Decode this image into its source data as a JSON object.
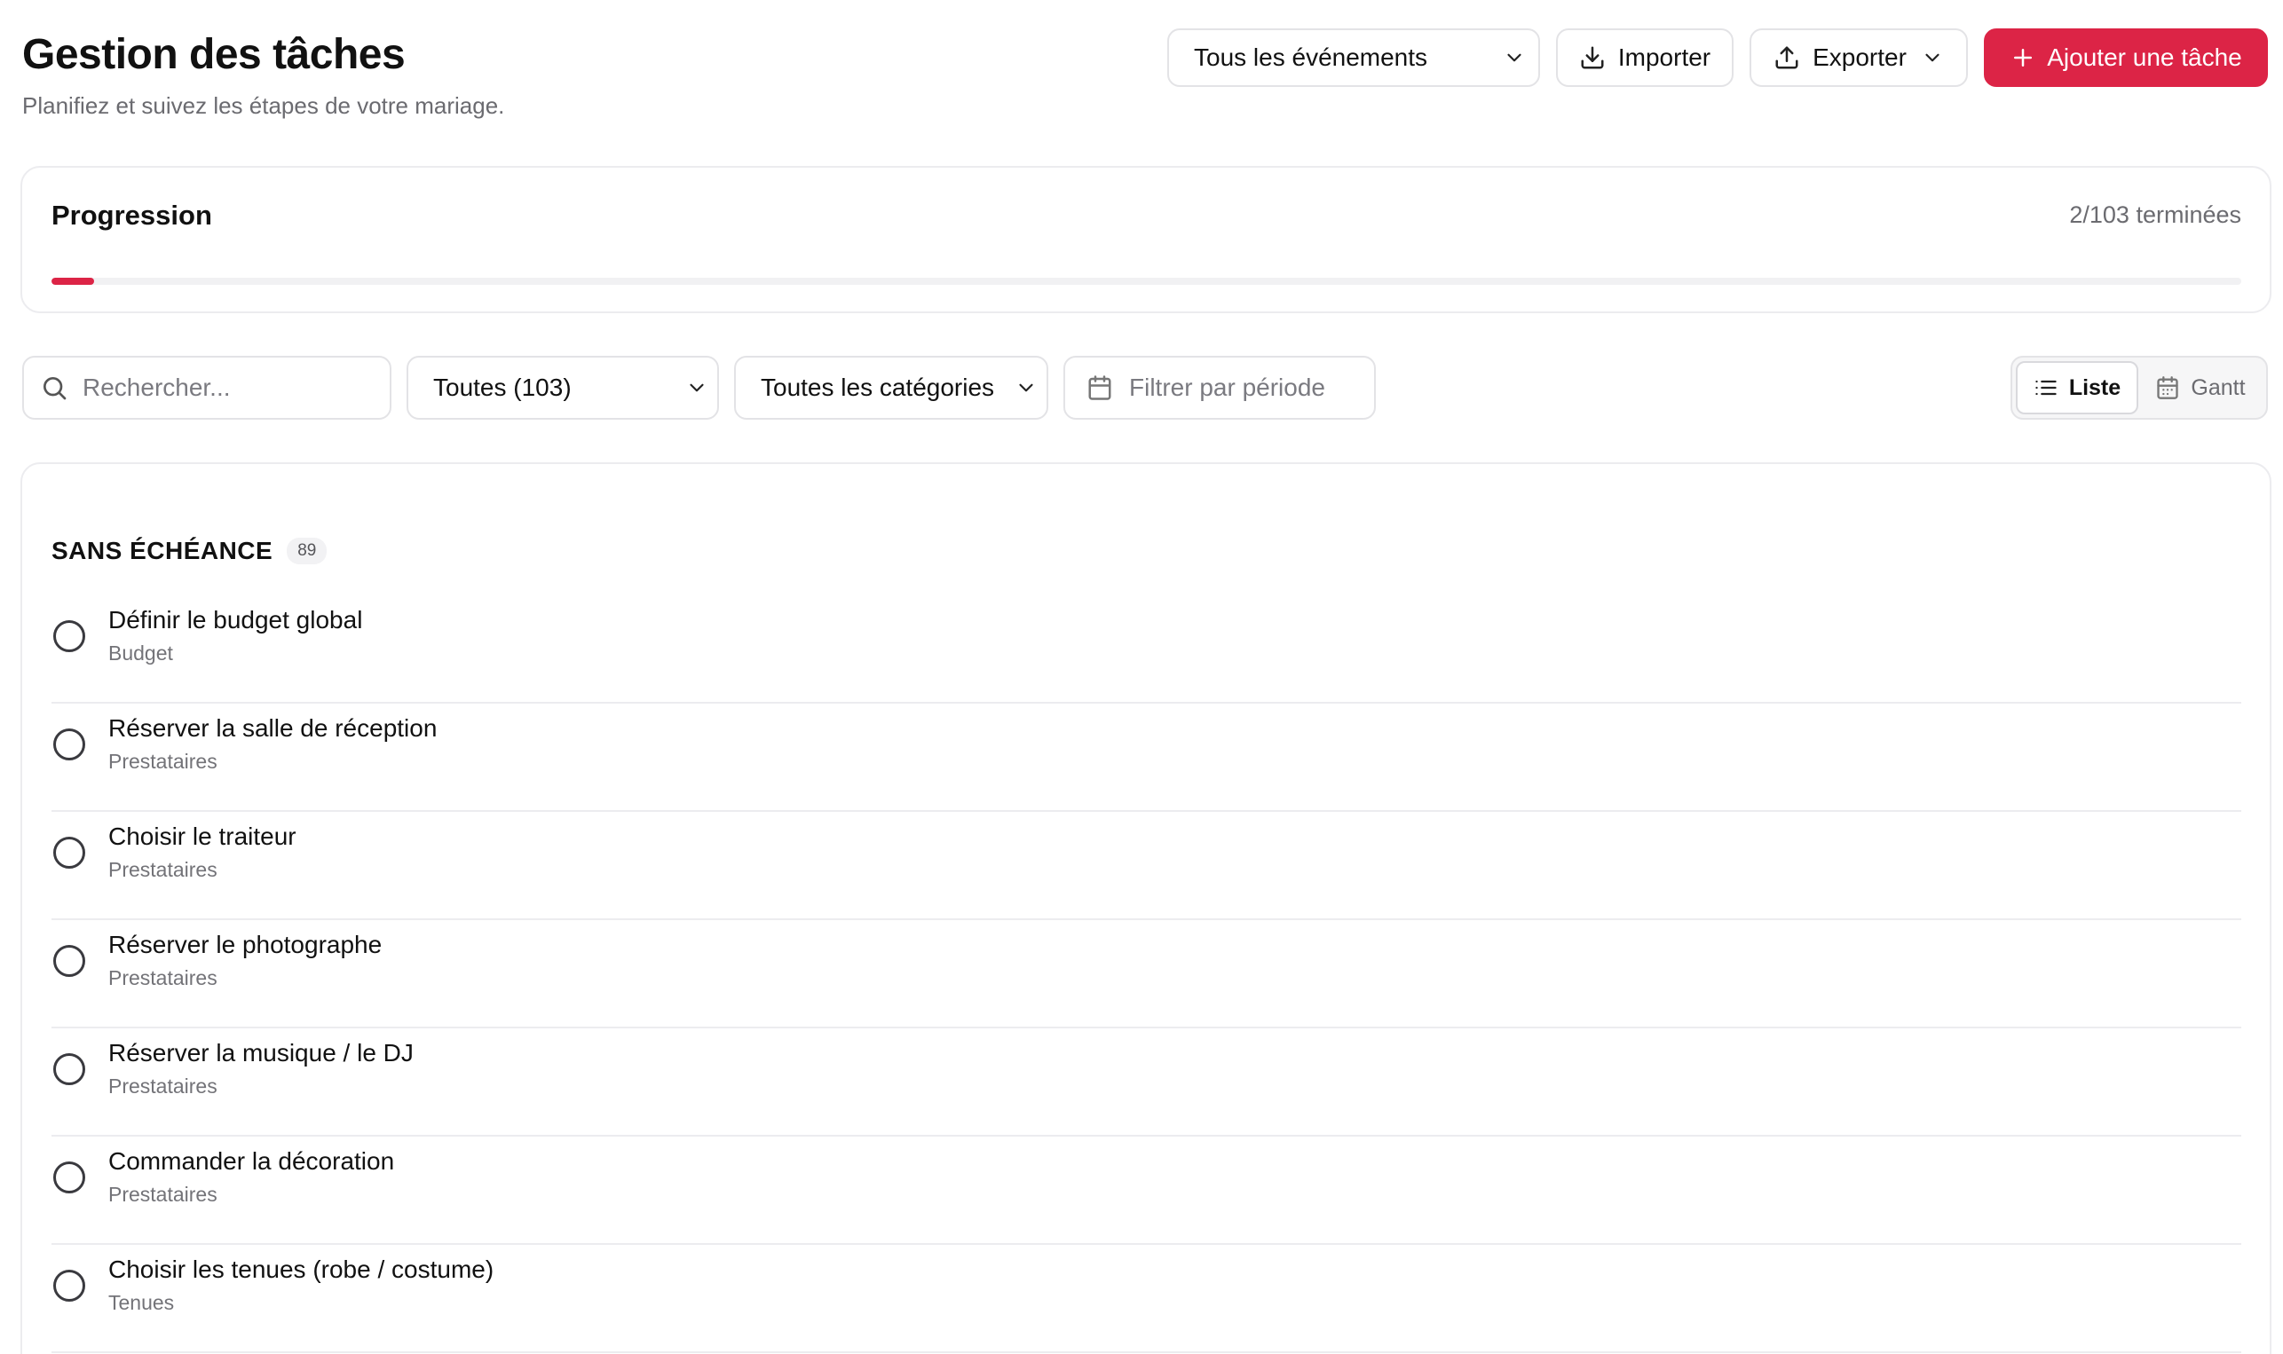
{
  "header": {
    "title": "Gestion des tâches",
    "subtitle": "Planifiez et suivez les étapes de votre mariage.",
    "event_select_value": "Tous les événements",
    "import_label": "Importer",
    "export_label": "Exporter",
    "add_task_label": "Ajouter une tâche",
    "accent_color": "#dc2446"
  },
  "progress": {
    "title": "Progression",
    "count_text": "2/103 terminées",
    "done": 2,
    "total": 103
  },
  "filters": {
    "search_placeholder": "Rechercher...",
    "status_value": "Toutes (103)",
    "category_value": "Toutes les catégories",
    "period_placeholder": "Filtrer par période",
    "view_list_label": "Liste",
    "view_gantt_label": "Gantt",
    "active_view": "Liste"
  },
  "group": {
    "title": "SANS ÉCHÉANCE",
    "count": "89",
    "tasks": [
      {
        "title": "Définir le budget global",
        "category": "Budget",
        "done": false
      },
      {
        "title": "Réserver la salle de réception",
        "category": "Prestataires",
        "done": false
      },
      {
        "title": "Choisir le traiteur",
        "category": "Prestataires",
        "done": false
      },
      {
        "title": "Réserver le photographe",
        "category": "Prestataires",
        "done": false
      },
      {
        "title": "Réserver la musique / le DJ",
        "category": "Prestataires",
        "done": false
      },
      {
        "title": "Commander la décoration",
        "category": "Prestataires",
        "done": false
      },
      {
        "title": "Choisir les tenues (robe / costume)",
        "category": "Tenues",
        "done": false
      }
    ]
  },
  "icons": {
    "chevron": "chevron-down-icon",
    "import": "download-icon",
    "export": "upload-icon",
    "add": "plus-icon",
    "search": "search-icon",
    "period": "calendar-icon",
    "list": "list-icon",
    "gantt": "calendar-grid-icon",
    "task_check": "circle-checkbox-icon"
  }
}
